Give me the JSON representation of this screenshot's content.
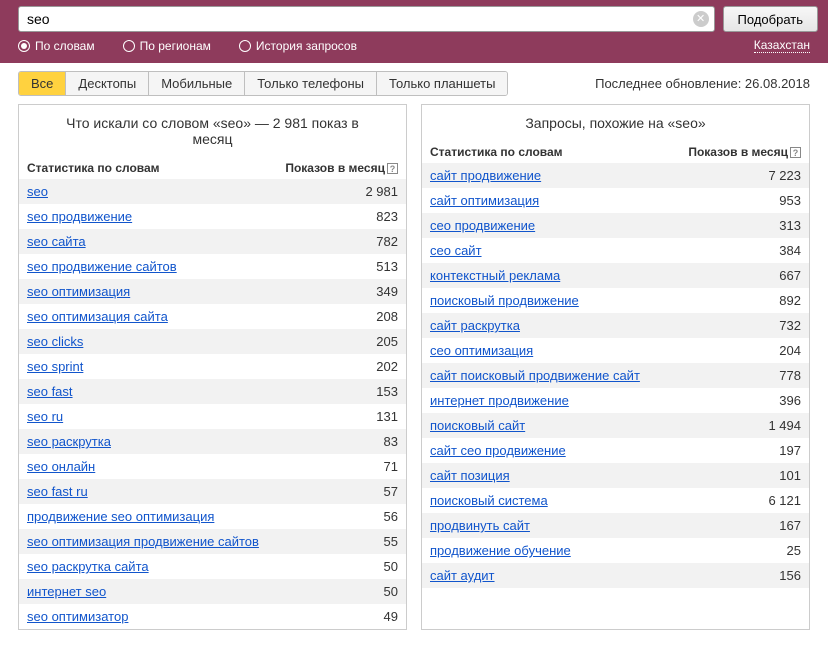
{
  "search": {
    "value": "seo",
    "submit_label": "Подобрать"
  },
  "filters": {
    "by_words": "По словам",
    "by_regions": "По регионам",
    "history": "История запросов",
    "region": "Казахстан"
  },
  "tabs": {
    "all": "Все",
    "desktops": "Десктопы",
    "mobile": "Мобильные",
    "phones_only": "Только телефоны",
    "tablets_only": "Только планшеты"
  },
  "last_update": "Последнее обновление: 26.08.2018",
  "headers": {
    "stats_by_words": "Статистика по словам",
    "impressions_per_month": "Показов в месяц"
  },
  "left_panel": {
    "title": "Что искали со словом «seo» — 2 981 показ в месяц",
    "rows": [
      {
        "kw": "seo",
        "count": "2 981"
      },
      {
        "kw": "seo продвижение",
        "count": "823"
      },
      {
        "kw": "seo сайта",
        "count": "782"
      },
      {
        "kw": "seo продвижение сайтов",
        "count": "513"
      },
      {
        "kw": "seo оптимизация",
        "count": "349"
      },
      {
        "kw": "seo оптимизация сайта",
        "count": "208"
      },
      {
        "kw": "seo clicks",
        "count": "205"
      },
      {
        "kw": "seo sprint",
        "count": "202"
      },
      {
        "kw": "seo fast",
        "count": "153"
      },
      {
        "kw": "seo ru",
        "count": "131"
      },
      {
        "kw": "seo раскрутка",
        "count": "83"
      },
      {
        "kw": "seo онлайн",
        "count": "71"
      },
      {
        "kw": "seo fast ru",
        "count": "57"
      },
      {
        "kw": "продвижение seo оптимизация",
        "count": "56"
      },
      {
        "kw": "seo оптимизация продвижение сайтов",
        "count": "55"
      },
      {
        "kw": "seo раскрутка сайта",
        "count": "50"
      },
      {
        "kw": "интернет seo",
        "count": "50"
      },
      {
        "kw": "seo оптимизатор",
        "count": "49"
      }
    ]
  },
  "right_panel": {
    "title": "Запросы, похожие на «seo»",
    "rows": [
      {
        "kw": "сайт продвижение",
        "count": "7 223"
      },
      {
        "kw": "сайт оптимизация",
        "count": "953"
      },
      {
        "kw": "сео продвижение",
        "count": "313"
      },
      {
        "kw": "сео сайт",
        "count": "384"
      },
      {
        "kw": "контекстный реклама",
        "count": "667"
      },
      {
        "kw": "поисковый продвижение",
        "count": "892"
      },
      {
        "kw": "сайт раскрутка",
        "count": "732"
      },
      {
        "kw": "сео оптимизация",
        "count": "204"
      },
      {
        "kw": "сайт поисковый продвижение сайт",
        "count": "778"
      },
      {
        "kw": "интернет продвижение",
        "count": "396"
      },
      {
        "kw": "поисковый сайт",
        "count": "1 494"
      },
      {
        "kw": "сайт сео продвижение",
        "count": "197"
      },
      {
        "kw": "сайт позиция",
        "count": "101"
      },
      {
        "kw": "поисковый система",
        "count": "6 121"
      },
      {
        "kw": "продвинуть сайт",
        "count": "167"
      },
      {
        "kw": "продвижение обучение",
        "count": "25"
      },
      {
        "kw": "сайт аудит",
        "count": "156"
      }
    ]
  }
}
